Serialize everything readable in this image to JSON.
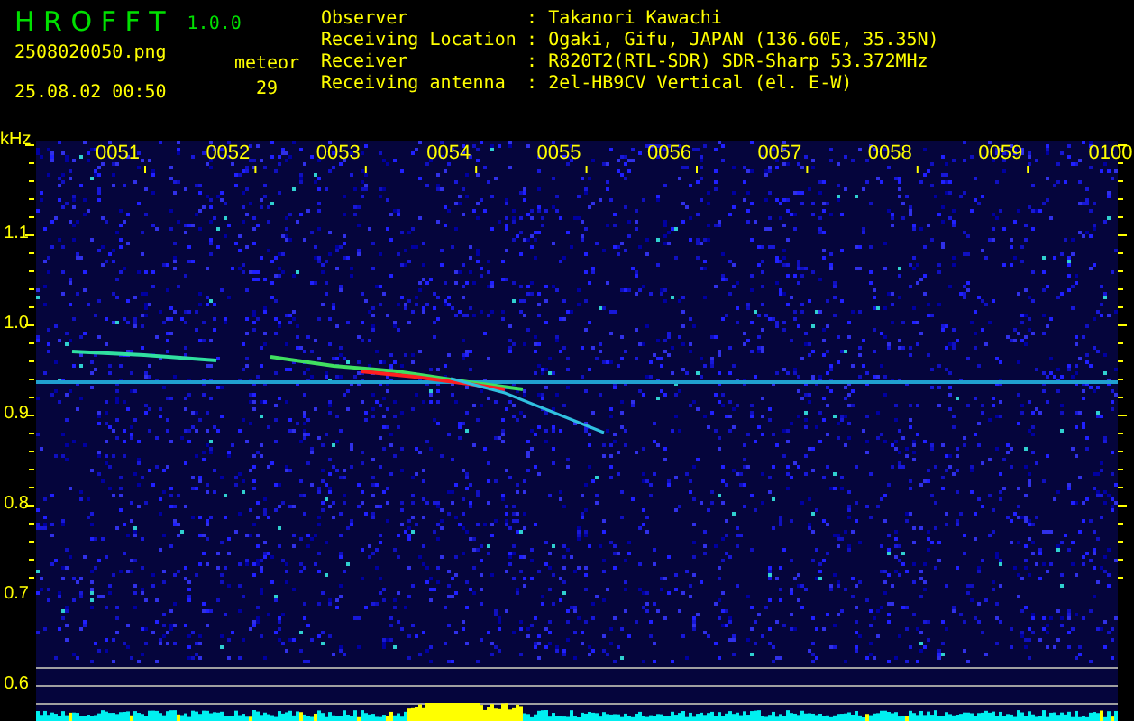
{
  "app": {
    "name": "H R O F F T",
    "version": "1.0.0"
  },
  "file": {
    "filename": "2508020050.png",
    "timestamp": "25.08.02 00:50"
  },
  "meteor": {
    "label": "meteor",
    "count": "29"
  },
  "station": [
    {
      "label": "Observer",
      "sep": ":",
      "value": "Takanori Kawachi"
    },
    {
      "label": "Receiving Location",
      "sep": ":",
      "value": "Ogaki, Gifu, JAPAN (136.60E, 35.35N)"
    },
    {
      "label": "Receiver",
      "sep": ":",
      "value": "R820T2(RTL-SDR) SDR-Sharp 53.372MHz"
    },
    {
      "label": "Receiving antenna",
      "sep": ":",
      "value": "2el-HB9CV Vertical (el. E-W)"
    }
  ],
  "spectrogram": {
    "y_unit": "kHz",
    "y_labels": [
      "1.1",
      "1.0",
      "0.9",
      "0.8",
      "0.7",
      "0.6"
    ],
    "time_labels": [
      "0051",
      "0052",
      "0053",
      "0054",
      "0055",
      "0056",
      "0057",
      "0058",
      "0059",
      "0100"
    ]
  }
}
